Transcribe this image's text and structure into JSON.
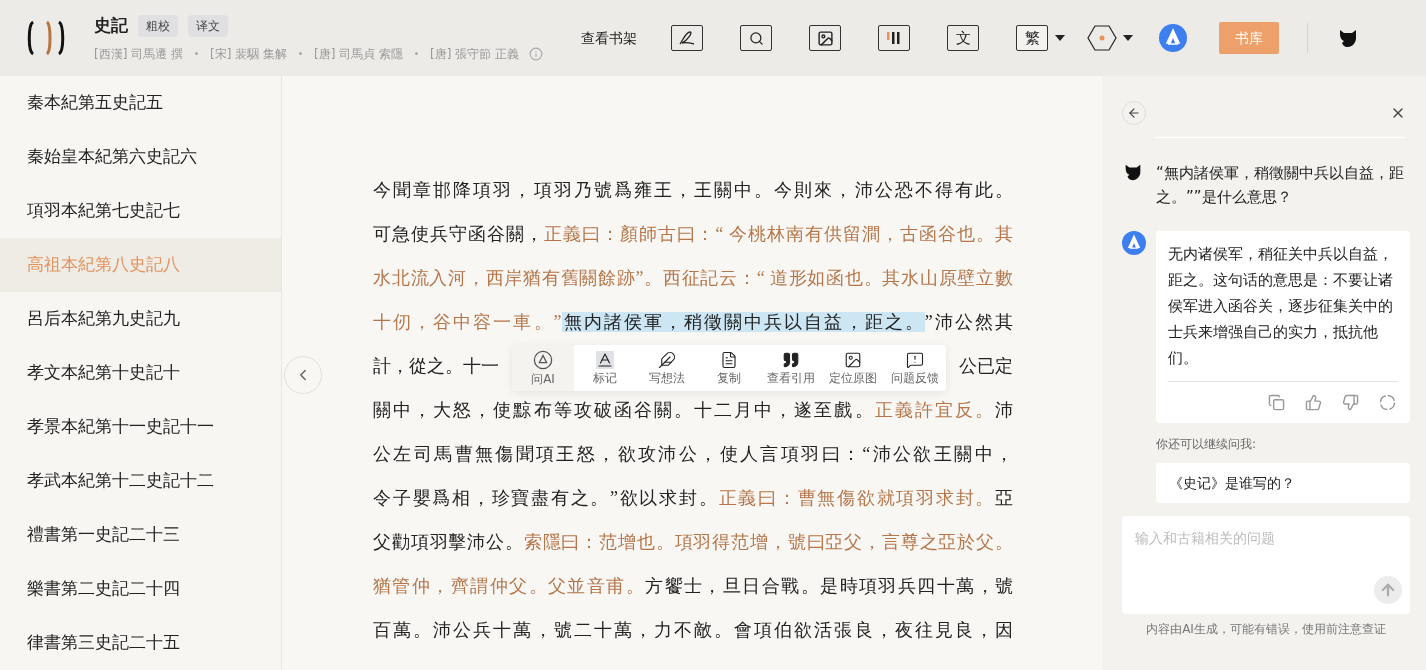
{
  "header": {
    "title": "史記",
    "tags": [
      "粗校",
      "译文"
    ],
    "authors": [
      "[西漢] 司馬遷 撰",
      "[宋] 裴駰 集解",
      "[唐] 司馬貞 索隱",
      "[唐] 張守節 正義"
    ],
    "bookshelf_link": "查看书架",
    "translate_label": "文",
    "script_label": "繁",
    "library_button": "书库"
  },
  "sidebar": {
    "items": [
      {
        "label": "秦本紀第五史記五",
        "selected": false
      },
      {
        "label": "秦始皇本紀第六史記六",
        "selected": false
      },
      {
        "label": "項羽本紀第七史記七",
        "selected": false
      },
      {
        "label": "高祖本紀第八史記八",
        "selected": true
      },
      {
        "label": "呂后本紀第九史記九",
        "selected": false
      },
      {
        "label": "孝文本紀第十史記十",
        "selected": false
      },
      {
        "label": "孝景本紀第十一史記十一",
        "selected": false
      },
      {
        "label": "孝武本紀第十二史記十二",
        "selected": false
      },
      {
        "label": "禮書第一史記二十三",
        "selected": false
      },
      {
        "label": "樂書第二史記二十四",
        "selected": false
      },
      {
        "label": "律書第三史記二十五",
        "selected": false
      }
    ]
  },
  "reader": {
    "lines": [
      {
        "kind": "full",
        "segments": [
          {
            "kind": "main",
            "text": "今聞章邯降項羽，項羽乃號爲雍王，王關中。今則來，沛公恐不得有此。"
          }
        ]
      },
      {
        "kind": "full",
        "segments": [
          {
            "kind": "main",
            "text": "可急使兵守函谷關，"
          },
          {
            "kind": "note",
            "text": "正義曰：顏師古曰：“ 今桃林南有供留澗，古函谷也。其"
          }
        ]
      },
      {
        "kind": "full",
        "segments": [
          {
            "kind": "note",
            "text": "水北流入河，西岸猶有舊關餘跡”。西征記云：“ 道形如函也。其水山原壁立數"
          }
        ]
      },
      {
        "kind": "full",
        "segments": [
          {
            "kind": "note",
            "text": "十仞，谷中容一車。”"
          },
          {
            "kind": "highlight",
            "text": "無内諸侯軍，稍徵關中兵以自益，距之。"
          },
          {
            "kind": "main",
            "text": "”沛公然其"
          }
        ]
      },
      {
        "kind": "split",
        "left": "計，從之。十一",
        "right": "公已定"
      },
      {
        "kind": "full",
        "segments": [
          {
            "kind": "main",
            "text": "關中，大怒，使黥布等攻破函谷關。十二月中，遂至戲。"
          },
          {
            "kind": "note",
            "text": "正義許宜反。"
          },
          {
            "kind": "main",
            "text": "沛"
          }
        ]
      },
      {
        "kind": "full",
        "segments": [
          {
            "kind": "main",
            "text": "公左司馬曹無傷聞項王怒，欲攻沛公，使人言項羽曰：“沛公欲王關中，"
          }
        ]
      },
      {
        "kind": "full",
        "segments": [
          {
            "kind": "main",
            "text": "令子嬰爲相，珍寶盡有之。”欲以求封。"
          },
          {
            "kind": "note",
            "text": "正義曰：曹無傷欲就項羽求封。"
          },
          {
            "kind": "main",
            "text": "亞"
          }
        ]
      },
      {
        "kind": "full",
        "segments": [
          {
            "kind": "main",
            "text": "父勸項羽擊沛公。"
          },
          {
            "kind": "note",
            "text": "索隱曰：范增也。項羽得范增，號曰亞父，言尊之亞於父。"
          }
        ]
      },
      {
        "kind": "full",
        "segments": [
          {
            "kind": "note",
            "text": "猶管仲，齊謂仲父。父並音甫。"
          },
          {
            "kind": "main",
            "text": "方饗士，旦日合戰。是時項羽兵四十萬，號"
          }
        ]
      },
      {
        "kind": "full",
        "segments": [
          {
            "kind": "main",
            "text": "百萬。沛公兵十萬，號二十萬，力不敵。會項伯欲活張良，夜往見良，因"
          }
        ]
      }
    ]
  },
  "selection_toolbar": {
    "items": [
      {
        "kind": "ai",
        "label": "问AI"
      },
      {
        "kind": "mark",
        "label": "标记"
      },
      {
        "kind": "note",
        "label": "写想法"
      },
      {
        "kind": "copy",
        "label": "复制"
      },
      {
        "kind": "quote",
        "label": "查看引用"
      },
      {
        "kind": "image",
        "label": "定位原图"
      },
      {
        "kind": "feedback",
        "label": "问题反馈"
      }
    ]
  },
  "chat": {
    "user_message": "“無内諸侯軍，稍徵關中兵以自益，距之。””是什么意思？",
    "ai_answer": "无内诸侯军，稍征关中兵以自益，距之。这句话的意思是：不要让诸侯军进入函谷关，逐步征集关中的士兵来增强自己的实力，抵抗他们。",
    "follow_up_label": "你还可以继续问我:",
    "suggestions": [
      "《史记》是谁写的？"
    ],
    "input": {
      "placeholder": "输入和古籍相关的问题"
    },
    "disclaimer": "内容由AI生成，可能有错误，使用前注意查证"
  }
}
